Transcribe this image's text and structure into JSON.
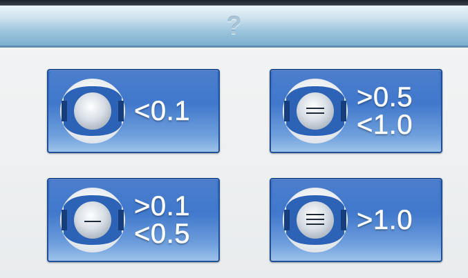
{
  "header": {
    "help_glyph": "?"
  },
  "options": [
    {
      "icon": "slight-wear-tire-icon",
      "lines": [
        "<0.1"
      ]
    },
    {
      "icon": "heavy-wear-tire-icon",
      "lines": [
        ">0.5",
        "<1.0"
      ]
    },
    {
      "icon": "moderate-wear-tire-icon",
      "lines": [
        ">0.1",
        "<0.5"
      ]
    },
    {
      "icon": "severe-wear-tire-icon",
      "lines": [
        ">1.0"
      ]
    }
  ],
  "colors": {
    "header": "#9fc6de",
    "tile": "#3f77cb",
    "tile_border": "#1f4e94",
    "ring": "#2d63b6",
    "text": "#ffffff"
  }
}
